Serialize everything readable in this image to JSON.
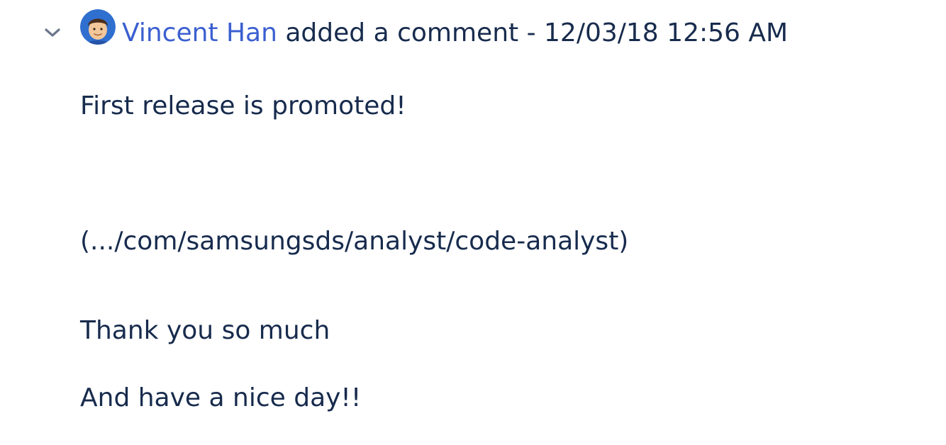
{
  "comment": {
    "author": "Vincent Han",
    "action": "added a comment",
    "separator": "-",
    "timestamp": "12/03/18 12:56 AM",
    "body": [
      "First release is promoted!",
      "(.../com/samsungsds/analyst/code-analyst)",
      "Thank you so much",
      "And have a nice day!!"
    ]
  },
  "icons": {
    "toggle": "chevron-down-icon",
    "avatar": "user-avatar-icon"
  },
  "colors": {
    "author_link": "#3b5fd0",
    "text": "#172b4d",
    "avatar_bg": "#2f6fcf"
  }
}
